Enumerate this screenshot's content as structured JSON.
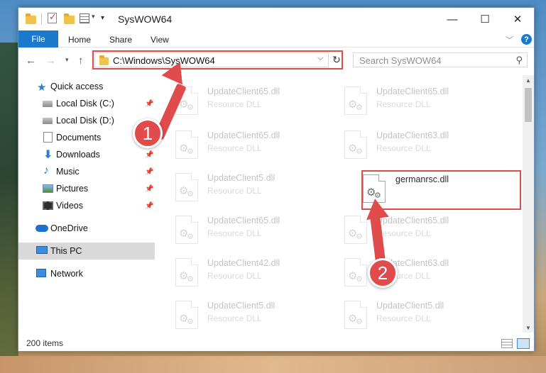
{
  "window": {
    "title": "SysWOW64",
    "controls": {
      "minimize": "—",
      "maximize": "☐",
      "close": "✕"
    }
  },
  "ribbon": {
    "tabs": [
      "File",
      "Home",
      "Share",
      "View"
    ],
    "help": "?"
  },
  "address": {
    "path": "C:\\Windows\\SysWOW64",
    "search_placeholder": "Search SysWOW64"
  },
  "nav_pane": {
    "items": [
      {
        "label": "Quick access",
        "icon": "star-icon",
        "pinned": false
      },
      {
        "label": "Local Disk (C:)",
        "icon": "drive-icon",
        "pinned": true
      },
      {
        "label": "Local Disk (D:)",
        "icon": "drive-icon",
        "pinned": false
      },
      {
        "label": "Documents",
        "icon": "documents-icon",
        "pinned": false
      },
      {
        "label": "Downloads",
        "icon": "downloads-icon",
        "pinned": true
      },
      {
        "label": "Music",
        "icon": "music-icon",
        "pinned": true
      },
      {
        "label": "Pictures",
        "icon": "pictures-icon",
        "pinned": true
      },
      {
        "label": "Videos",
        "icon": "videos-icon",
        "pinned": true
      },
      {
        "label": "OneDrive",
        "icon": "onedrive-icon",
        "pinned": false
      },
      {
        "label": "This PC",
        "icon": "this-pc-icon",
        "pinned": false,
        "selected": true
      },
      {
        "label": "Network",
        "icon": "network-icon",
        "pinned": false
      }
    ]
  },
  "files": [
    {
      "name": "UpdateClient65.dll",
      "type": "Resource DLL"
    },
    {
      "name": "UpdateClient65.dll",
      "type": "Resource DLL"
    },
    {
      "name": "UpdateClient65.dll",
      "type": "Resource DLL"
    },
    {
      "name": "UpdateClient63.dll",
      "type": "Resource DLL"
    },
    {
      "name": "UpdateClient5.dll",
      "type": "Resource DLL"
    },
    {
      "name": "germanrsc.dll",
      "type": "",
      "highlighted": true
    },
    {
      "name": "UpdateClient65.dll",
      "type": "Resource DLL"
    },
    {
      "name": "UpdateClient65.dll",
      "type": "Resource DLL"
    },
    {
      "name": "UpdateClient42.dll",
      "type": "Resource DLL"
    },
    {
      "name": "UpdateClient63.dll",
      "type": "Resource DLL"
    },
    {
      "name": "UpdateClient5.dll",
      "type": "Resource DLL"
    },
    {
      "name": "UpdateClient5.dll",
      "type": "Resource DLL"
    }
  ],
  "status": {
    "item_count": "200 items"
  },
  "annotations": {
    "step1": "1",
    "step2": "2"
  },
  "colors": {
    "accent": "#1979ca",
    "annotation": "#e04b4b",
    "selected_nav": "#d9d9d9"
  }
}
